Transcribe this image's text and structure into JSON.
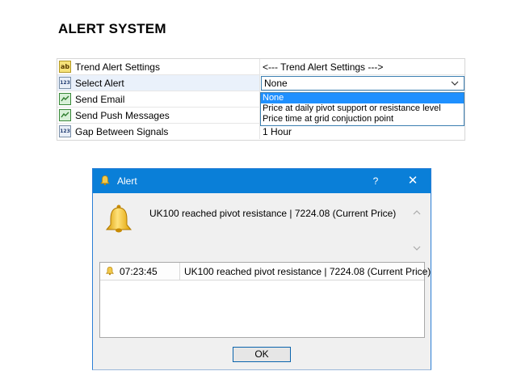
{
  "page_title": "ALERT SYSTEM",
  "properties": {
    "rows": [
      {
        "type_icon": "ab",
        "icon_name": "string-type-icon",
        "name": "Trend Alert Settings",
        "value": "<--- Trend Alert Settings --->"
      },
      {
        "type_icon": "123",
        "icon_name": "enum-type-icon",
        "name": "Select Alert",
        "value": "None"
      },
      {
        "type_icon": "",
        "icon_name": "bool-type-icon",
        "name": "Send Email",
        "value": ""
      },
      {
        "type_icon": "",
        "icon_name": "bool-type-icon",
        "name": "Send Push Messages",
        "value": ""
      },
      {
        "type_icon": "123",
        "icon_name": "number-type-icon",
        "name": "Gap Between Signals",
        "value": "1 Hour"
      }
    ],
    "dropdown_options": [
      "None",
      "Price at daily pivot support or resistance level",
      "Price time at grid conjuction point"
    ],
    "selected_option": "None"
  },
  "dialog": {
    "title": "Alert",
    "help_label": "?",
    "close_label": "✕",
    "message": "UK100 reached pivot resistance | 7224.08 (Current Price)",
    "log": [
      {
        "time": "07:23:45",
        "message": "UK100 reached pivot resistance | 7224.08 (Current Price)"
      }
    ],
    "ok_label": "OK"
  },
  "colors": {
    "titlebar": "#0a7fd8",
    "selection": "#1e90ff",
    "bell": "#f2b705"
  }
}
